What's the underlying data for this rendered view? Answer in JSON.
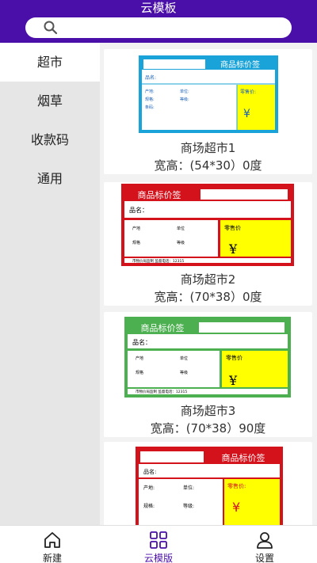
{
  "header": {
    "title": "云模板"
  },
  "search": {
    "placeholder": ""
  },
  "sidebar": {
    "items": [
      {
        "label": "超市",
        "active": true
      },
      {
        "label": "烟草",
        "active": false
      },
      {
        "label": "收款码",
        "active": false
      },
      {
        "label": "通用",
        "active": false
      }
    ]
  },
  "templates": [
    {
      "name": "商场超市1",
      "size": "宽高：(54*30）0度",
      "thumb": {
        "title": "商品标价签",
        "product": "品名:",
        "origin": "产地:",
        "unit": "单位:",
        "spec": "规格:",
        "grade": "等级:",
        "barcode": "条码:",
        "price_label": "零售价:",
        "currency": "¥",
        "footer": ""
      }
    },
    {
      "name": "商场超市2",
      "size": "宽高：(70*38）0度",
      "thumb": {
        "title": "商品标价签",
        "product": "品名：",
        "origin": "产地",
        "unit": "单位",
        "spec": "规格",
        "grade": "等级",
        "barcode": "",
        "price_label": "零售价",
        "currency": "¥",
        "footer": "市物价局监制 监督电话：12315"
      }
    },
    {
      "name": "商场超市3",
      "size": "宽高：(70*38）90度",
      "thumb": {
        "title": "商品标价签",
        "product": "品名：",
        "origin": "产地",
        "unit": "单位",
        "spec": "规格",
        "grade": "等级",
        "barcode": "",
        "price_label": "零售价",
        "currency": "¥",
        "footer": "市物价局监制 监督电话：12315"
      }
    },
    {
      "name": "",
      "size": "",
      "thumb": {
        "title": "商品标价签",
        "product": "品名:",
        "origin": "产地:",
        "unit": "单位:",
        "spec": "规格:",
        "grade": "等级:",
        "barcode": "",
        "price_label": "零售价:",
        "currency": "¥",
        "footer": ""
      }
    }
  ],
  "tabbar": {
    "items": [
      {
        "label": "新建",
        "icon": "home-icon"
      },
      {
        "label": "云模版",
        "icon": "grid-icon",
        "active": true
      },
      {
        "label": "设置",
        "icon": "user-icon"
      }
    ]
  },
  "colors": {
    "header": "#4a0fa8",
    "blue": "#1aa3d9",
    "red": "#d4121c",
    "green": "#4caf50",
    "yellow": "#ffff00"
  }
}
